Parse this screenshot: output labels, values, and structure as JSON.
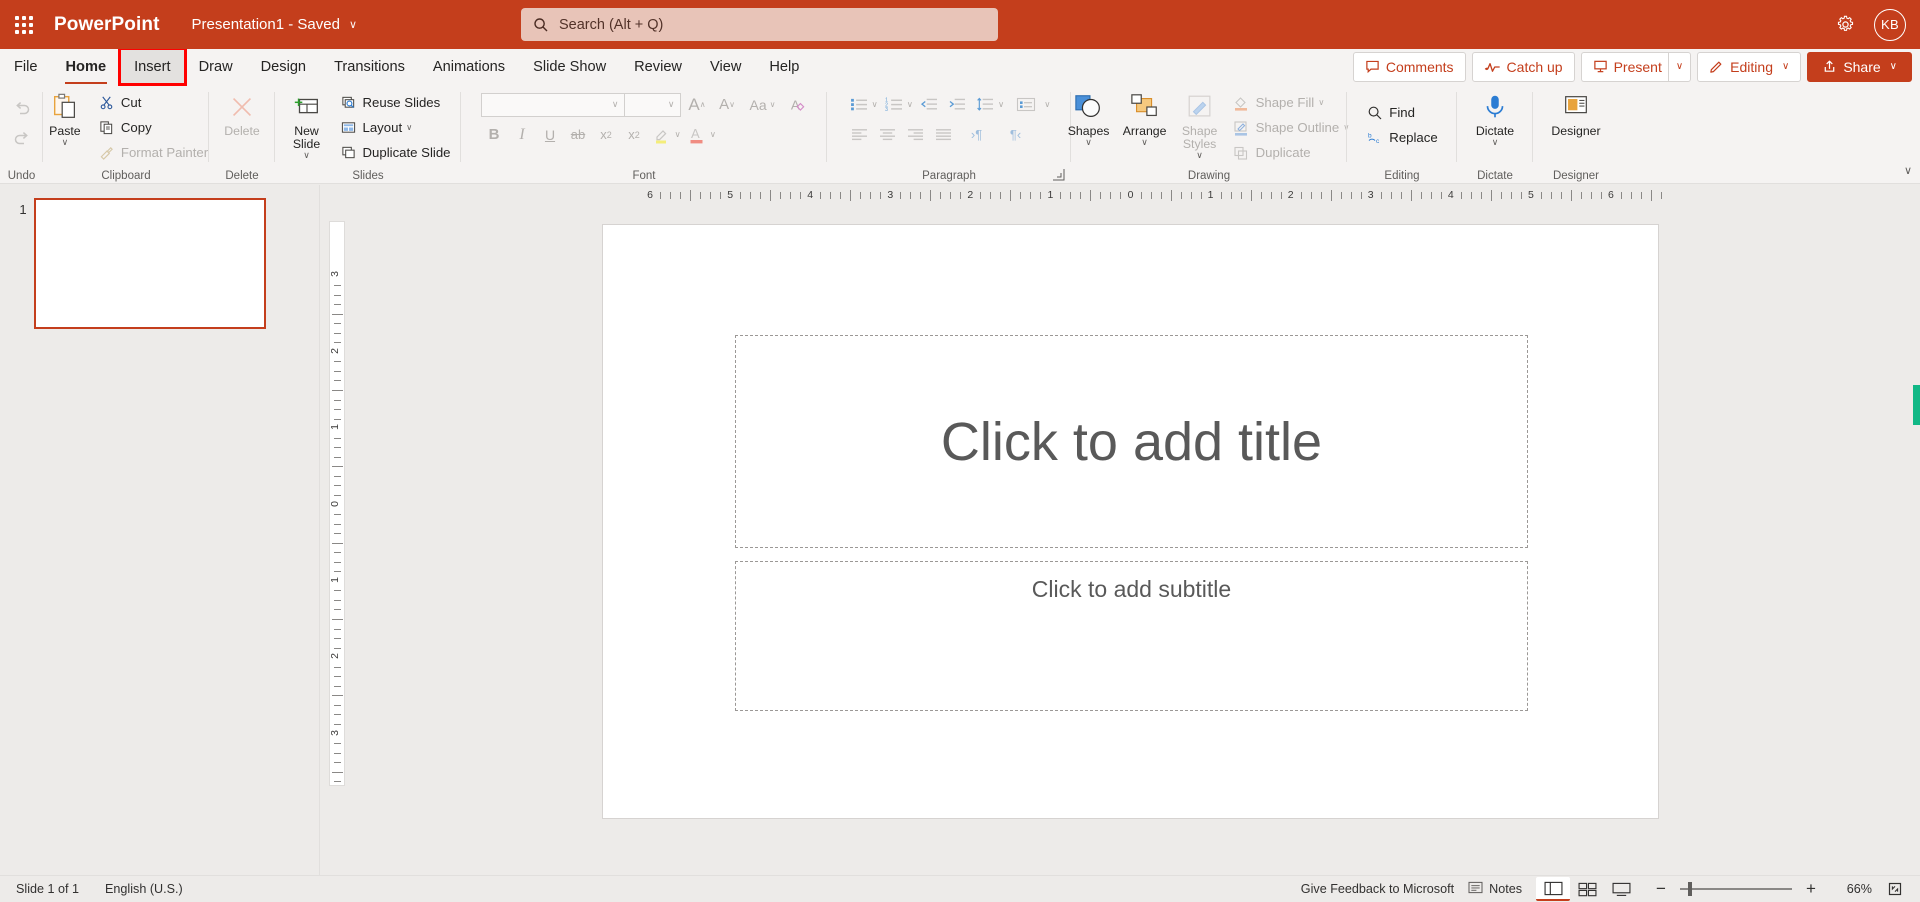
{
  "titlebar": {
    "waffle_icon": "app-launcher-waffle-icon",
    "brand": "PowerPoint",
    "document_title": "Presentation1  -  Saved",
    "title_chevron": "∨",
    "search_placeholder": "Search (Alt + Q)",
    "search_value": "",
    "settings_icon": "gear-icon",
    "avatar_initials": "KB",
    "bg_color": "#C43E1C"
  },
  "tabs": [
    {
      "label": "File",
      "active": false,
      "highlighted": false
    },
    {
      "label": "Home",
      "active": true,
      "highlighted": false
    },
    {
      "label": "Insert",
      "active": false,
      "highlighted": true
    },
    {
      "label": "Draw",
      "active": false,
      "highlighted": false
    },
    {
      "label": "Design",
      "active": false,
      "highlighted": false
    },
    {
      "label": "Transitions",
      "active": false,
      "highlighted": false
    },
    {
      "label": "Animations",
      "active": false,
      "highlighted": false
    },
    {
      "label": "Slide Show",
      "active": false,
      "highlighted": false
    },
    {
      "label": "Review",
      "active": false,
      "highlighted": false
    },
    {
      "label": "View",
      "active": false,
      "highlighted": false
    },
    {
      "label": "Help",
      "active": false,
      "highlighted": false
    }
  ],
  "tab_actions": {
    "comments": "Comments",
    "catch_up": "Catch up",
    "present": "Present",
    "present_arrow": "∨",
    "editing": "Editing",
    "editing_arrow": "∨",
    "share": "Share",
    "share_arrow": "∨"
  },
  "ribbon": {
    "groups": {
      "undo": {
        "label": "Undo",
        "undo_icon": "undo-arrow-icon",
        "redo_icon": "redo-arrow-icon"
      },
      "clipboard": {
        "label": "Clipboard",
        "paste": "Paste",
        "paste_caret": "∨",
        "cut": "Cut",
        "copy": "Copy",
        "format_painter": "Format Painter"
      },
      "delete": {
        "label": "Delete",
        "delete": "Delete"
      },
      "slides": {
        "label": "Slides",
        "new_slide": "New Slide",
        "new_slide_caret": "∨",
        "reuse_slides": "Reuse Slides",
        "layout": "Layout",
        "layout_caret": "∨",
        "duplicate_slide": "Duplicate Slide"
      },
      "font": {
        "label": "Font",
        "font_name": "",
        "font_size": "",
        "grow_font": "A",
        "shrink_font": "A",
        "change_case": "Aa",
        "clear_formatting": "A",
        "bold": "B",
        "italic": "I",
        "underline": "U",
        "strikethrough": "ab",
        "subscript": "x",
        "superscript": "x",
        "highlight": "highlight-pen-icon",
        "font_color": "A"
      },
      "paragraph": {
        "label": "Paragraph",
        "bullets": "bullets-icon",
        "numbering": "numbering-icon",
        "decrease_indent": "decrease-indent-icon",
        "increase_indent": "increase-indent-icon",
        "line_spacing": "line-spacing-icon",
        "text_direction": "text-direction-icon",
        "align_left": "align-left-icon",
        "align_center": "align-center-icon",
        "align_right": "align-right-icon",
        "justify": "justify-icon",
        "ltr": "›¶",
        "rtl": "¶‹"
      },
      "drawing": {
        "label": "Drawing",
        "shapes": "Shapes",
        "shapes_caret": "∨",
        "arrange": "Arrange",
        "arrange_caret": "∨",
        "shape_styles": "Shape Styles",
        "shape_styles_caret": "∨",
        "shape_fill": "Shape Fill",
        "shape_fill_caret": "∨",
        "shape_outline": "Shape Outline",
        "shape_outline_caret": "∨",
        "duplicate": "Duplicate"
      },
      "editing": {
        "label": "Editing",
        "find": "Find",
        "replace": "Replace"
      },
      "dictate": {
        "label": "Dictate",
        "dictate": "Dictate",
        "dictate_caret": "∨"
      },
      "designer": {
        "label": "Designer",
        "designer": "Designer"
      }
    },
    "collapse_caret": "∨"
  },
  "thumbnails": {
    "slides": [
      {
        "number": "1"
      }
    ]
  },
  "rulers": {
    "horizontal_numbers": [
      "6",
      "5",
      "4",
      "3",
      "2",
      "1",
      "0",
      "1",
      "2",
      "3",
      "4",
      "5",
      "6"
    ],
    "vertical_numbers": [
      "3",
      "2",
      "1",
      "0",
      "1",
      "2",
      "3"
    ]
  },
  "slide": {
    "title_placeholder": "Click to add title",
    "subtitle_placeholder": "Click to add subtitle"
  },
  "statusbar": {
    "slide_count": "Slide 1 of 1",
    "language": "English (U.S.)",
    "feedback": "Give Feedback to Microsoft",
    "notes": "Notes",
    "notes_icon": "notes-icon",
    "views": [
      {
        "name": "normal-view",
        "active": true
      },
      {
        "name": "slide-sorter-view",
        "active": false
      },
      {
        "name": "reading-view",
        "active": false
      }
    ],
    "zoom_out": "−",
    "zoom_in": "+",
    "zoom_level": "66%",
    "fit_icon": "fit-to-window-icon"
  },
  "colors": {
    "accent": "#C43E1C",
    "highlight_box": "#FF0000",
    "scroll_marker": "#12B886"
  }
}
